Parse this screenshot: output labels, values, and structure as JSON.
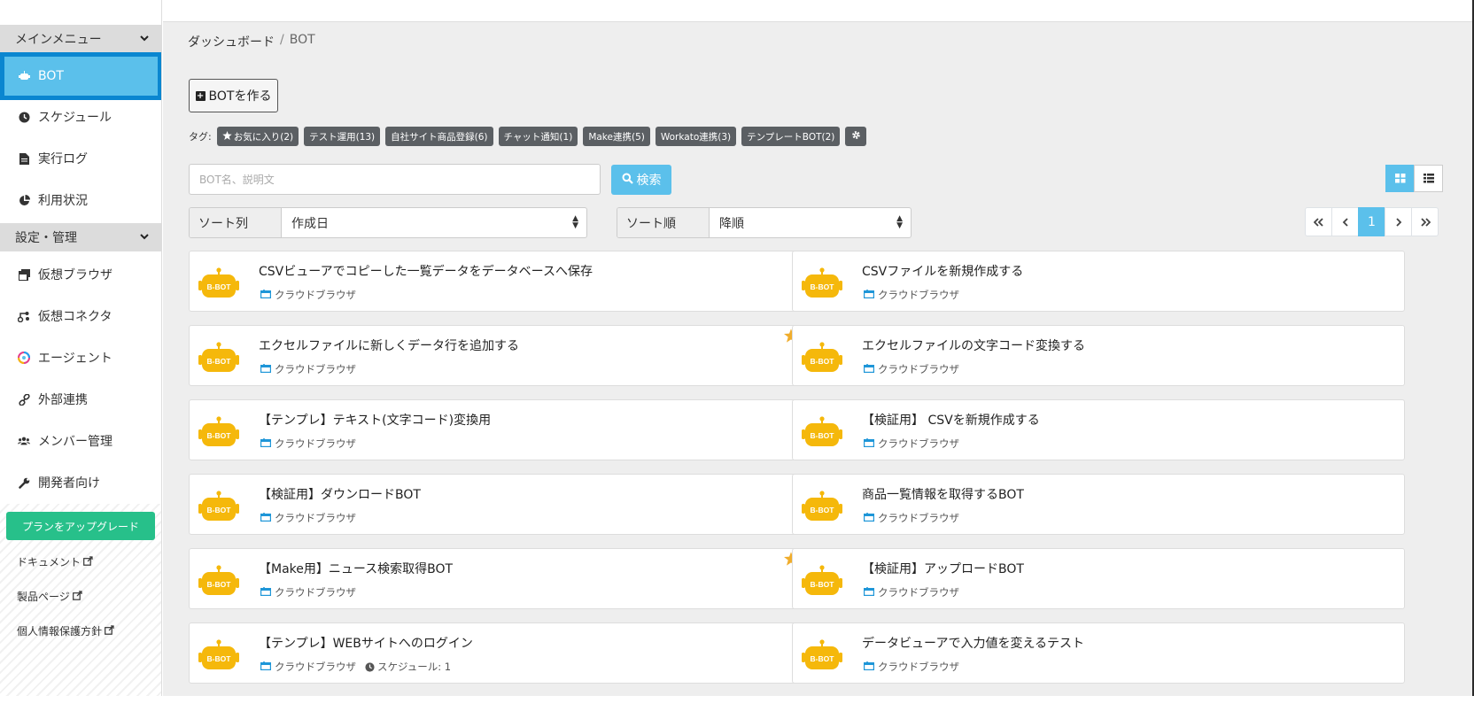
{
  "sidebar": {
    "main_menu_header": "メインメニュー",
    "settings_header": "設定・管理",
    "items": [
      {
        "label": "BOT",
        "icon": "robot-icon"
      },
      {
        "label": "スケジュール",
        "icon": "clock-icon"
      },
      {
        "label": "実行ログ",
        "icon": "file-icon"
      },
      {
        "label": "利用状況",
        "icon": "pie-chart-icon"
      },
      {
        "label": "仮想ブラウザ",
        "icon": "windows-icon"
      },
      {
        "label": "仮想コネクタ",
        "icon": "connector-icon"
      },
      {
        "label": "エージェント",
        "icon": "agent-icon"
      },
      {
        "label": "外部連携",
        "icon": "link-icon"
      },
      {
        "label": "メンバー管理",
        "icon": "users-icon"
      },
      {
        "label": "開発者向け",
        "icon": "wrench-icon"
      }
    ],
    "upgrade_label": "プランをアップグレード",
    "links": [
      {
        "label": "ドキュメント"
      },
      {
        "label": "製品ページ"
      },
      {
        "label": "個人情報保護方針"
      }
    ]
  },
  "breadcrumb": {
    "home": "ダッシュボード",
    "separator": "/",
    "current": "BOT"
  },
  "create_button_label": "BOTを作る",
  "tags": {
    "label": "タグ:",
    "items": [
      "お気に入り(2)",
      "テスト運用(13)",
      "自社サイト商品登録(6)",
      "チャット通知(1)",
      "Make連携(5)",
      "Workato連携(3)",
      "テンプレートBOT(2)"
    ]
  },
  "search": {
    "placeholder": "BOT名、説明文",
    "button_label": "検索"
  },
  "sort": {
    "column_label": "ソート列",
    "column_value": "作成日",
    "order_label": "ソート順",
    "order_value": "降順"
  },
  "pagination": {
    "first": "«",
    "prev": "‹",
    "current": "1",
    "next": "›",
    "last": "»"
  },
  "bot_icon_label": "B-BOT",
  "cards": [
    {
      "title": "CSVビューアでコピーした一覧データをデータベースへ保存",
      "browser": "クラウドブラウザ",
      "favorite": false
    },
    {
      "title": "CSVファイルを新規作成する",
      "browser": "クラウドブラウザ",
      "favorite": false
    },
    {
      "title": "エクセルファイルに新しくデータ行を追加する",
      "browser": "クラウドブラウザ",
      "favorite": true
    },
    {
      "title": "エクセルファイルの文字コード変換する",
      "browser": "クラウドブラウザ",
      "favorite": false
    },
    {
      "title": "【テンプレ】テキスト(文字コード)変換用",
      "browser": "クラウドブラウザ",
      "favorite": false
    },
    {
      "title": "【検証用】 CSVを新規作成する",
      "browser": "クラウドブラウザ",
      "favorite": false
    },
    {
      "title": "【検証用】ダウンロードBOT",
      "browser": "クラウドブラウザ",
      "favorite": false
    },
    {
      "title": "商品一覧情報を取得するBOT",
      "browser": "クラウドブラウザ",
      "favorite": false
    },
    {
      "title": "【Make用】ニュース検索取得BOT",
      "browser": "クラウドブラウザ",
      "favorite": true
    },
    {
      "title": "【検証用】アップロードBOT",
      "browser": "クラウドブラウザ",
      "favorite": false
    },
    {
      "title": "【テンプレ】WEBサイトへのログイン",
      "browser": "クラウドブラウザ",
      "favorite": false,
      "schedule": "スケジュール: 1"
    },
    {
      "title": "データビューアで入力値を変えるテスト",
      "browser": "クラウドブラウザ",
      "favorite": false
    }
  ],
  "colors": {
    "accent": "#5bc0eb",
    "active_border": "#0a86d0",
    "upgrade": "#27c08a",
    "tag_bg": "#5b5f63",
    "bot_yellow": "#f5b80b",
    "star": "#f0ad2c"
  }
}
